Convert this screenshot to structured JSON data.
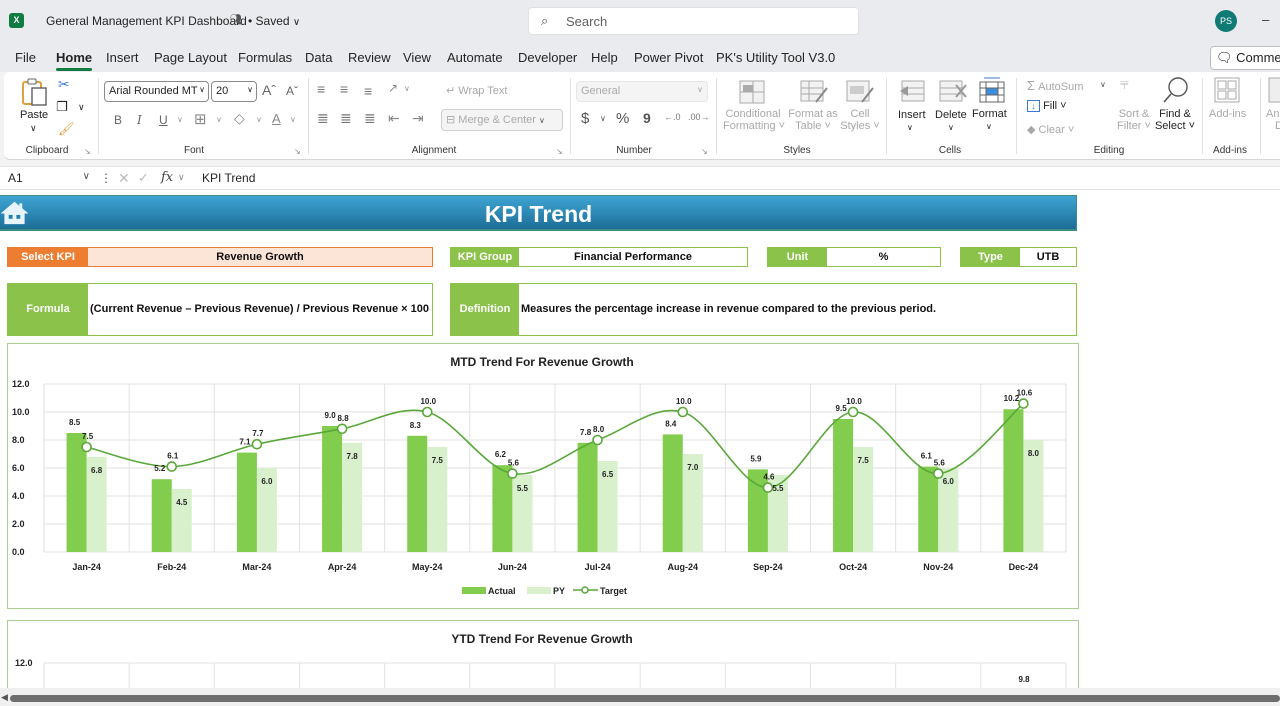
{
  "titlebar": {
    "app_icon": "excel-logo-icon",
    "app_icon_text": "X",
    "doc_title": "General Management KPI Dashboard",
    "saved_status": "• Saved",
    "search_placeholder": "Search",
    "avatar_initials": "PS",
    "minimize": "–"
  },
  "menu": {
    "tabs": [
      "File",
      "Home",
      "Insert",
      "Page Layout",
      "Formulas",
      "Data",
      "Review",
      "View",
      "Automate",
      "Developer",
      "Help",
      "Power Pivot",
      "PK's Utility Tool V3.0"
    ],
    "active_tab": "Home",
    "comments_label": "Comments"
  },
  "ribbon": {
    "clipboard": {
      "label": "Clipboard",
      "paste": "Paste"
    },
    "font": {
      "label": "Font",
      "font_name": "Arial Rounded MT",
      "font_size": "20",
      "bold": "B",
      "italic": "I",
      "underline": "U"
    },
    "alignment": {
      "label": "Alignment",
      "wrap_text": "Wrap Text",
      "merge_center": "Merge & Center"
    },
    "number": {
      "label": "Number",
      "format": "General",
      "currency": "$",
      "percent": "%",
      "comma": "9",
      "inc_dec": "←.0 .00",
      "dec_dec": ".00 →.0"
    },
    "styles": {
      "label": "Styles",
      "conditional_1": "Conditional",
      "conditional_2": "Formatting ˅",
      "format_table_1": "Format as",
      "format_table_2": "Table ˅",
      "cell_styles_1": "Cell",
      "cell_styles_2": "Styles ˅"
    },
    "cells": {
      "label": "Cells",
      "insert": "Insert",
      "delete": "Delete",
      "format": "Format"
    },
    "editing": {
      "label": "Editing",
      "autosum": "AutoSum",
      "fill": "Fill ˅",
      "clear": "Clear ˅",
      "sort_1": "Sort &",
      "sort_2": "Filter ˅",
      "find_1": "Find &",
      "find_2": "Select ˅"
    },
    "addins": {
      "label": "Add-ins",
      "addins_btn": "Add-ins",
      "analyze_1": "Ana",
      "analyze_2": "D"
    }
  },
  "formula_bar": {
    "cell_ref": "A1",
    "fx": "fx",
    "value": "KPI Trend"
  },
  "dashboard": {
    "title": "KPI Trend",
    "select_kpi_label": "Select KPI",
    "select_kpi_value": "Revenue Growth",
    "kpi_group_label": "KPI Group",
    "kpi_group_value": "Financial Performance",
    "unit_label": "Unit",
    "unit_value": "%",
    "type_label": "Type",
    "type_value": "UTB",
    "formula_label": "Formula",
    "formula_value": "(Current Revenue – Previous Revenue) / Previous Revenue × 100",
    "definition_label": "Definition",
    "definition_value": "Measures the percentage increase in revenue compared to the previous period.",
    "colors": {
      "orange": "#ed7d31",
      "orange_fill": "#fce4d6",
      "green": "#8bc34a",
      "banner": "#1f7fae",
      "actual": "#82cc4e",
      "py": "#d8f0cc",
      "target": "#5aa83a"
    }
  },
  "chart_data": [
    {
      "type": "bar",
      "title": "MTD Trend For Revenue Growth",
      "categories": [
        "Jan-24",
        "Feb-24",
        "Mar-24",
        "Apr-24",
        "May-24",
        "Jun-24",
        "Jul-24",
        "Aug-24",
        "Sep-24",
        "Oct-24",
        "Nov-24",
        "Dec-24"
      ],
      "series": [
        {
          "name": "Actual",
          "kind": "bar",
          "values": [
            8.5,
            5.2,
            7.1,
            9.0,
            8.3,
            6.2,
            7.8,
            8.4,
            5.9,
            9.5,
            6.1,
            10.2
          ]
        },
        {
          "name": "PY",
          "kind": "bar",
          "values": [
            6.8,
            4.5,
            6.0,
            7.8,
            7.5,
            5.5,
            6.5,
            7.0,
            5.5,
            7.5,
            6.0,
            8.0
          ]
        },
        {
          "name": "Target",
          "kind": "line",
          "values": [
            7.5,
            6.1,
            7.7,
            8.8,
            10.0,
            5.6,
            8.0,
            10.0,
            4.6,
            10.0,
            5.6,
            10.6
          ]
        }
      ],
      "xlabel": "",
      "ylabel": "",
      "ylim": [
        0,
        12
      ],
      "yticks": [
        "0.0",
        "2.0",
        "4.0",
        "6.0",
        "8.0",
        "10.0",
        "12.0"
      ],
      "grid": true,
      "legend": "bottom"
    },
    {
      "type": "bar",
      "title": "YTD Trend For Revenue Growth",
      "yticks_visible": [
        "12.0"
      ],
      "visible_labels": [
        "9.8"
      ],
      "ylim": [
        0,
        12
      ],
      "grid": true,
      "note": "partially visible (cut off by scroll)"
    }
  ]
}
